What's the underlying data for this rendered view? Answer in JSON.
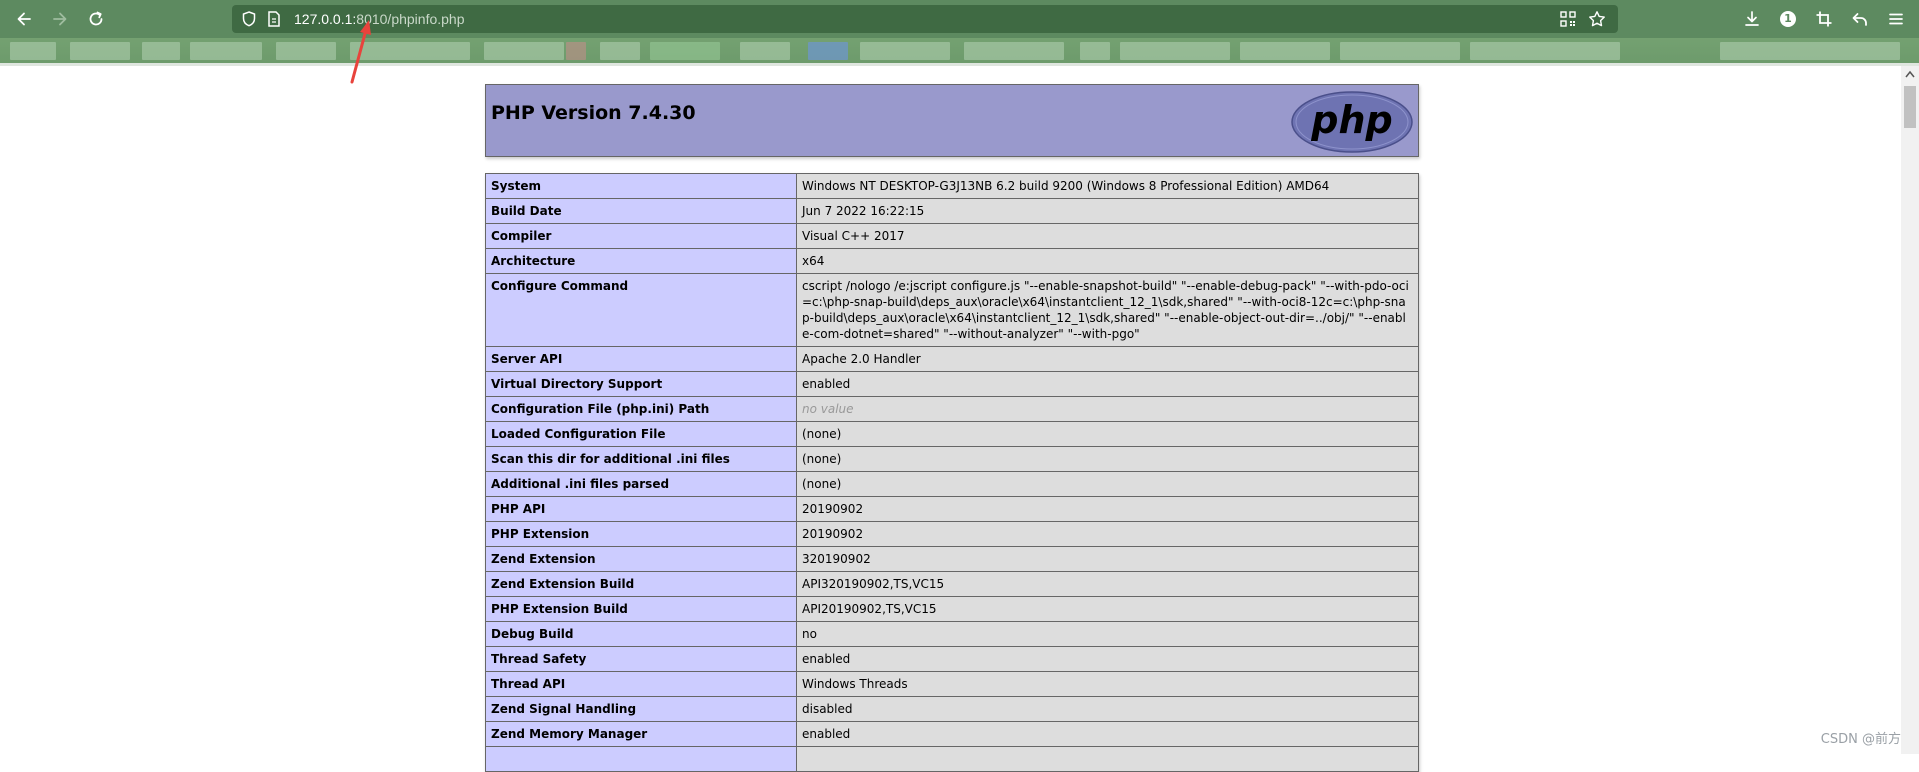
{
  "browser": {
    "url_host": "127.0.0.1:",
    "url_rest": "8010/phpinfo.php"
  },
  "colors": {
    "toolbar": "#5d8a60",
    "header_bg": "#9999cc",
    "label_bg": "#ccccff",
    "value_bg": "#dddddd",
    "annotation_arrow": "#e8433c"
  },
  "icons": {
    "back": "back-arrow-icon",
    "forward": "forward-arrow-icon",
    "reload": "reload-icon",
    "shield": "shield-icon",
    "page": "page-icon",
    "qr": "qr-code-icon",
    "star": "bookmark-star-icon",
    "download": "download-icon",
    "info": "info-icon",
    "crop": "crop-icon",
    "undo": "undo-icon",
    "menu": "menu-icon"
  },
  "info_badge": "1",
  "page": {
    "title": "PHP Version 7.4.30",
    "logo_text": "php",
    "rows": [
      {
        "label": "System",
        "value": "Windows NT DESKTOP-G3J13NB 6.2 build 9200 (Windows 8 Professional Edition) AMD64"
      },
      {
        "label": "Build Date",
        "value": "Jun 7 2022 16:22:15"
      },
      {
        "label": "Compiler",
        "value": "Visual C++ 2017"
      },
      {
        "label": "Architecture",
        "value": "x64"
      },
      {
        "label": "Configure Command",
        "value": "cscript /nologo /e:jscript configure.js \"--enable-snapshot-build\" \"--enable-debug-pack\" \"--with-pdo-oci=c:\\php-snap-build\\deps_aux\\oracle\\x64\\instantclient_12_1\\sdk,shared\" \"--with-oci8-12c=c:\\php-snap-build\\deps_aux\\oracle\\x64\\instantclient_12_1\\sdk,shared\" \"--enable-object-out-dir=../obj/\" \"--enable-com-dotnet=shared\" \"--without-analyzer\" \"--with-pgo\""
      },
      {
        "label": "Server API",
        "value": "Apache 2.0 Handler"
      },
      {
        "label": "Virtual Directory Support",
        "value": "enabled"
      },
      {
        "label": "Configuration File (php.ini) Path",
        "value": "no value",
        "no_value": true
      },
      {
        "label": "Loaded Configuration File",
        "value": "(none)"
      },
      {
        "label": "Scan this dir for additional .ini files",
        "value": "(none)"
      },
      {
        "label": "Additional .ini files parsed",
        "value": "(none)"
      },
      {
        "label": "PHP API",
        "value": "20190902"
      },
      {
        "label": "PHP Extension",
        "value": "20190902"
      },
      {
        "label": "Zend Extension",
        "value": "320190902"
      },
      {
        "label": "Zend Extension Build",
        "value": "API320190902,TS,VC15"
      },
      {
        "label": "PHP Extension Build",
        "value": "API20190902,TS,VC15"
      },
      {
        "label": "Debug Build",
        "value": "no"
      },
      {
        "label": "Thread Safety",
        "value": "enabled"
      },
      {
        "label": "Thread API",
        "value": "Windows Threads"
      },
      {
        "label": "Zend Signal Handling",
        "value": "disabled"
      },
      {
        "label": "Zend Memory Manager",
        "value": "enabled"
      },
      {
        "label": "",
        "value": ""
      }
    ]
  },
  "watermark": "CSDN @前方"
}
